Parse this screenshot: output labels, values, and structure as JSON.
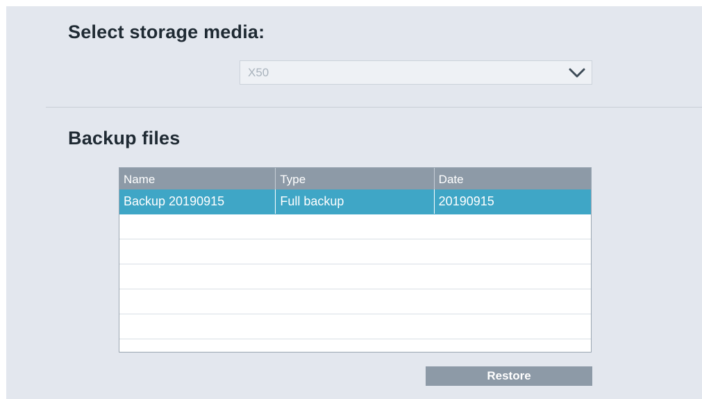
{
  "storage": {
    "title": "Select storage media:",
    "selected": "X50",
    "chevron_icon": "chevron-down-icon"
  },
  "backup": {
    "title": "Backup files",
    "columns": [
      "Name",
      "Type",
      "Date"
    ],
    "rows": [
      [
        "Backup 20190915",
        "Full backup",
        "20190915"
      ]
    ],
    "empty_rows": 5,
    "restore_label": "Restore"
  },
  "colors": {
    "panel_bg": "#e3e7ee",
    "header_bg": "#8d9aa7",
    "selected_row": "#3fa6c6",
    "button_bg": "#8d9aa7"
  }
}
